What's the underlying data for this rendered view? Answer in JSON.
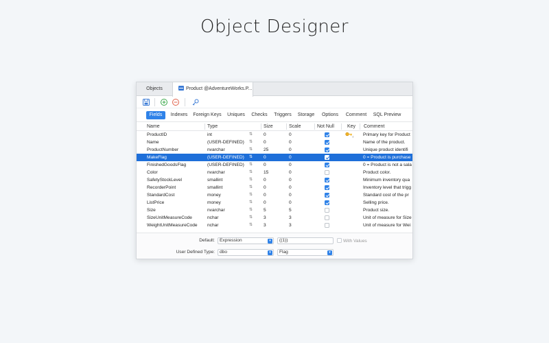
{
  "headline": "Object Designer",
  "window_tabs": [
    {
      "label": "Objects"
    },
    {
      "label": "Product @AdventureWorks.P..."
    }
  ],
  "toolbar": {
    "icons": [
      "save-icon",
      "add-field-icon",
      "remove-field-icon",
      "primary-key-icon"
    ]
  },
  "subtabs": [
    "Fields",
    "Indexes",
    "Foreign Keys",
    "Uniques",
    "Checks",
    "Triggers",
    "Storage",
    "Options",
    "Comment",
    "SQL Preview"
  ],
  "active_subtab": "Fields",
  "columns": [
    "Name",
    "Type",
    "Size",
    "Scale",
    "Not Null",
    "Key",
    "Comment"
  ],
  "fields": [
    {
      "name": "ProductID",
      "type": "int",
      "size": "0",
      "scale": "0",
      "not_null": true,
      "key": true,
      "comment": "Primary key for Product"
    },
    {
      "name": "Name",
      "type": "(USER-DEFINED)",
      "size": "0",
      "scale": "0",
      "not_null": true,
      "key": false,
      "comment": "Name of the product."
    },
    {
      "name": "ProductNumber",
      "type": "nvarchar",
      "size": "25",
      "scale": "0",
      "not_null": true,
      "key": false,
      "comment": "Unique product identifi"
    },
    {
      "name": "MakeFlag",
      "type": "(USER-DEFINED)",
      "size": "0",
      "scale": "0",
      "not_null": true,
      "key": false,
      "comment": "0 = Product is purchase",
      "selected": true
    },
    {
      "name": "FinishedGoodsFlag",
      "type": "(USER-DEFINED)",
      "size": "0",
      "scale": "0",
      "not_null": true,
      "key": false,
      "comment": "0 = Product is not a sala"
    },
    {
      "name": "Color",
      "type": "nvarchar",
      "size": "15",
      "scale": "0",
      "not_null": false,
      "key": false,
      "comment": "Product color."
    },
    {
      "name": "SafetyStockLevel",
      "type": "smallint",
      "size": "0",
      "scale": "0",
      "not_null": true,
      "key": false,
      "comment": "Minimum inventory qua"
    },
    {
      "name": "RecorderPoint",
      "type": "smallint",
      "size": "0",
      "scale": "0",
      "not_null": true,
      "key": false,
      "comment": "Inventory level that trigg"
    },
    {
      "name": "StandardCost",
      "type": "money",
      "size": "0",
      "scale": "0",
      "not_null": true,
      "key": false,
      "comment": "Standard cost of the pr"
    },
    {
      "name": "ListPrice",
      "type": "money",
      "size": "0",
      "scale": "0",
      "not_null": true,
      "key": false,
      "comment": "Selling price."
    },
    {
      "name": "Size",
      "type": "nvarchar",
      "size": "5",
      "scale": "5",
      "not_null": false,
      "key": false,
      "comment": "Product size."
    },
    {
      "name": "SizeUnitMeasureCode",
      "type": "nchar",
      "size": "3",
      "scale": "3",
      "not_null": false,
      "key": false,
      "comment": "Unit of measure for Size"
    },
    {
      "name": "WeightUnitMeasureCode",
      "type": "nchar",
      "size": "3",
      "scale": "3",
      "not_null": false,
      "key": false,
      "comment": "Unit of measure for Wei"
    }
  ],
  "properties": {
    "default_label": "Default:",
    "default_type": "Expression",
    "default_value": "((1))",
    "with_values_label": "With Values",
    "udt_label": "User Defined Type:",
    "udt_schema": "dbo",
    "udt_name": "Flag"
  },
  "colors": {
    "accent": "#2f82e8",
    "selection": "#1e6fd9",
    "background": "#f3f6f9"
  }
}
